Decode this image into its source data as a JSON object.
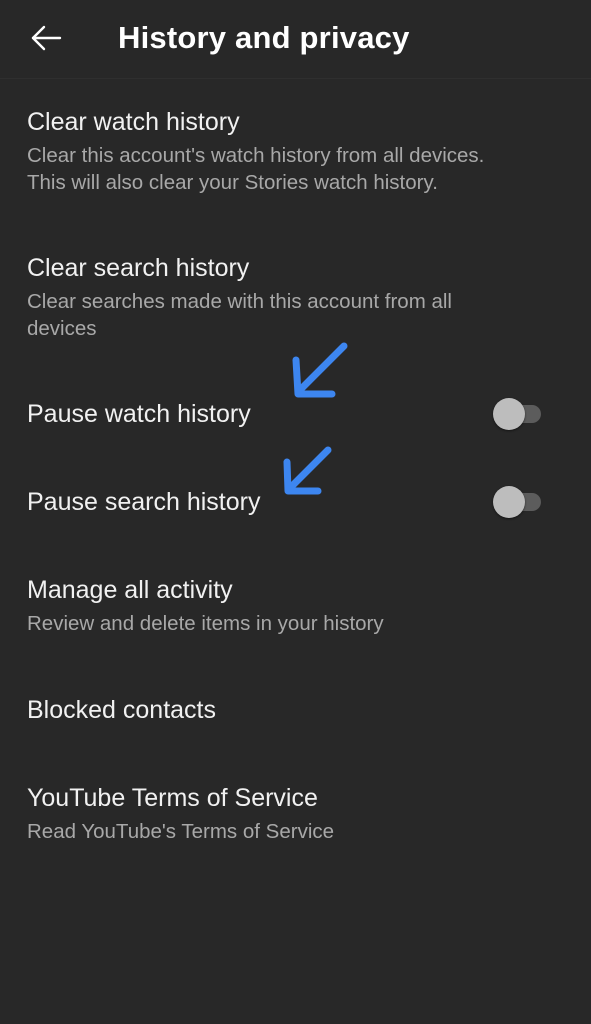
{
  "header": {
    "title": "History and privacy",
    "back_icon": "arrow-left-icon"
  },
  "settings": {
    "clear_watch": {
      "title": "Clear watch history",
      "subtitle_line1": "Clear this account's watch history from all devices.",
      "subtitle_line2": "This will also clear your Stories watch history."
    },
    "clear_search": {
      "title": "Clear search history",
      "subtitle_line1": "Clear searches made with this account from all",
      "subtitle_line2": "devices"
    },
    "pause_watch": {
      "title": "Pause watch history",
      "enabled": false
    },
    "pause_search": {
      "title": "Pause search history",
      "enabled": false
    },
    "manage_activity": {
      "title": "Manage all activity",
      "subtitle": "Review and delete items in your history"
    },
    "blocked_contacts": {
      "title": "Blocked contacts"
    },
    "terms": {
      "title": "YouTube Terms of Service",
      "subtitle": "Read YouTube's Terms of Service"
    }
  },
  "annotations": {
    "arrow_color": "#3d86f0",
    "arrow_icon": "arrow-down-left-icon"
  },
  "colors": {
    "background": "#282828",
    "primary_text": "#f1f1f1",
    "secondary_text": "#a8a8a8",
    "toggle_off_track": "#5c5c5c",
    "toggle_off_knob": "#bdbdbd"
  }
}
